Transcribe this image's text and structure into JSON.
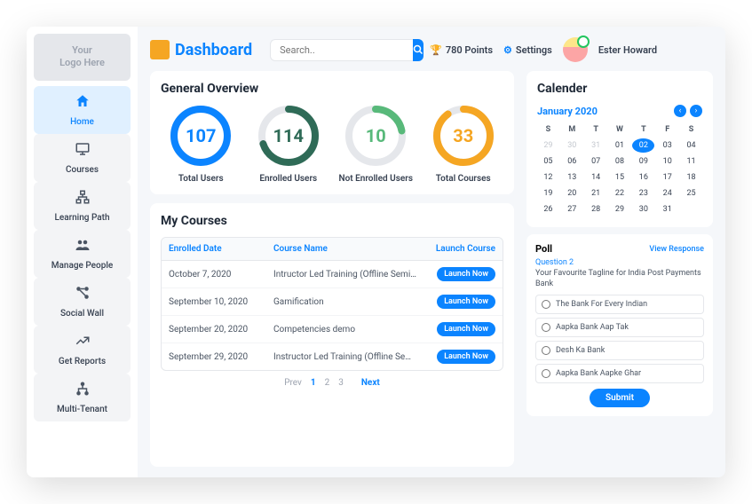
{
  "logo_placeholder": "Your\nLogo Here",
  "brand": "Dashboard",
  "search": {
    "placeholder": "Search.."
  },
  "topbar": {
    "points": "780 Points",
    "settings": "Settings",
    "user_name": "Ester Howard"
  },
  "sidebar": {
    "items": [
      {
        "label": "Home"
      },
      {
        "label": "Courses"
      },
      {
        "label": "Learning Path"
      },
      {
        "label": "Manage People"
      },
      {
        "label": "Social Wall"
      },
      {
        "label": "Get Reports"
      },
      {
        "label": "Multi-Tenant"
      }
    ]
  },
  "overview": {
    "title": "General Overview",
    "stats": [
      {
        "value": "107",
        "label": "Total Users",
        "color": "#0b84ff",
        "pct": 100
      },
      {
        "value": "114",
        "label": "Enrolled Users",
        "color": "#2f6b57",
        "pct": 70
      },
      {
        "value": "10",
        "label": "Not Enrolled Users",
        "color": "#58b97a",
        "pct": 22
      },
      {
        "value": "33",
        "label": "Total Courses",
        "color": "#f5a623",
        "pct": 90
      }
    ]
  },
  "courses": {
    "title": "My Courses",
    "cols": {
      "date": "Enrolled Date",
      "name": "Course Name",
      "action": "Launch Course"
    },
    "launch_label": "Launch Now",
    "rows": [
      {
        "date": "October 7, 2020",
        "name": "Intructor Led Training (Offline Seminars & Trainings)"
      },
      {
        "date": "September 10, 2020",
        "name": "Gamification"
      },
      {
        "date": "September 20, 2020",
        "name": "Competencies demo"
      },
      {
        "date": "September 29, 2020",
        "name": "Instructor Led Training (Offline Seminars)"
      }
    ],
    "pager": {
      "prev": "Prev",
      "pages": [
        "1",
        "2",
        "3"
      ],
      "next": "Next"
    }
  },
  "calendar": {
    "title": "Calender",
    "month": "January 2020",
    "dow": [
      "S",
      "M",
      "T",
      "W",
      "T",
      "F",
      "S"
    ],
    "lead_muted": [
      "29",
      "30",
      "31"
    ],
    "days": [
      "01",
      "02",
      "03",
      "04",
      "05",
      "06",
      "07",
      "08",
      "09",
      "10",
      "11",
      "12",
      "13",
      "14",
      "15",
      "16",
      "17",
      "18",
      "19",
      "20",
      "21",
      "22",
      "23",
      "24",
      "25",
      "26",
      "27",
      "28",
      "29",
      "30",
      "31"
    ],
    "selected": "02"
  },
  "poll": {
    "title": "Poll",
    "view": "View Response",
    "qnum": "Question 2",
    "question": "Your Favourite Tagline for India Post Payments Bank",
    "options": [
      "The Bank For Every Indian",
      "Aapka Bank Aap Tak",
      "Desh Ka Bank",
      "Aapka Bank Aapke Ghar"
    ],
    "submit": "Submit"
  }
}
